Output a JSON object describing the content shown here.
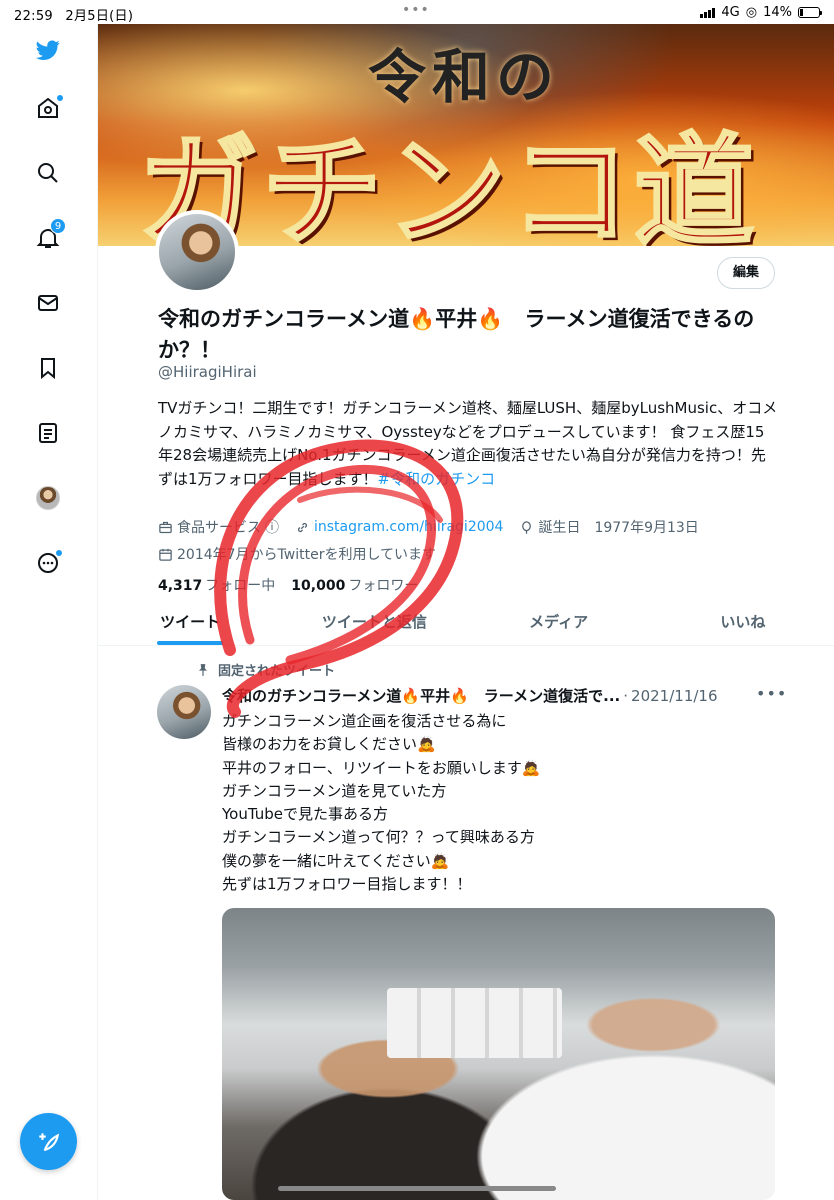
{
  "status_bar": {
    "time": "22:59",
    "date": "2月5日(日)",
    "multitask_dots": "•••",
    "network": "4G",
    "battery": "14%"
  },
  "sidebar": {
    "notification_count": "9",
    "icons": [
      "twitter-logo-icon",
      "home-icon",
      "search-icon",
      "bell-icon",
      "mail-icon",
      "bookmark-icon",
      "list-icon",
      "profile-avatar-icon",
      "more-icon"
    ]
  },
  "banner": {
    "subtitle": "令和の",
    "title": "ガチンコ道"
  },
  "profile": {
    "edit_label": "編集",
    "display_name": "令和のガチンコラーメン道🔥平井🔥　ラーメン道復活できるのか？！",
    "handle": "@HiiragiHirai",
    "bio": "TVガチンコ！二期生です！ガチンコラーメン道柊、麺屋LUSH、麺屋byLushMusic、オコメノカミサマ、ハラミノカミサマ、Oyssteyなどをプロデュースしています！ 食フェス歴15年28会場連続売上げNo.1ガチンコラーメン道企画復活させたい為自分が発信力を持つ！先ずは1万フォロワー目指します！",
    "bio_hashtag": "#令和のガチンコ",
    "category": "食品サービス",
    "category_info": "ⓘ",
    "link": "instagram.com/hiiragi2004",
    "birthday": "誕生日　1977年9月13日",
    "joined": "2014年7月からTwitterを利用しています",
    "following_count": "4,317",
    "following_label": "フォロー中",
    "followers_count": "10,000",
    "followers_label": "フォロワー"
  },
  "tabs": [
    {
      "label": "ツイート",
      "active": true
    },
    {
      "label": "ツイートと返信",
      "active": false
    },
    {
      "label": "メディア",
      "active": false
    },
    {
      "label": "いいね",
      "active": false
    }
  ],
  "pinned_tweet": {
    "pinned_label": "固定されたツイート",
    "author": "令和のガチンコラーメン道🔥平井🔥　ラーメン道復活で...",
    "separator": "·",
    "date": "2021/11/16",
    "more": "•••",
    "lines": [
      "ガチンコラーメン道企画を復活させる為に",
      "皆様のお力をお貸しください🙇",
      "平井のフォロー、リツイートをお願いします🙇",
      "ガチンコラーメン道を見ていた方",
      "YouTubeで見た事ある方",
      "ガチンコラーメン道って何？？って興味ある方",
      "僕の夢を一緒に叶えてください🙇",
      "先ずは1万フォロワー目指します！！"
    ]
  },
  "colors": {
    "accent": "#1d9bf0",
    "text": "#0f1419",
    "muted": "#536471",
    "annotation": "#e8262a"
  }
}
